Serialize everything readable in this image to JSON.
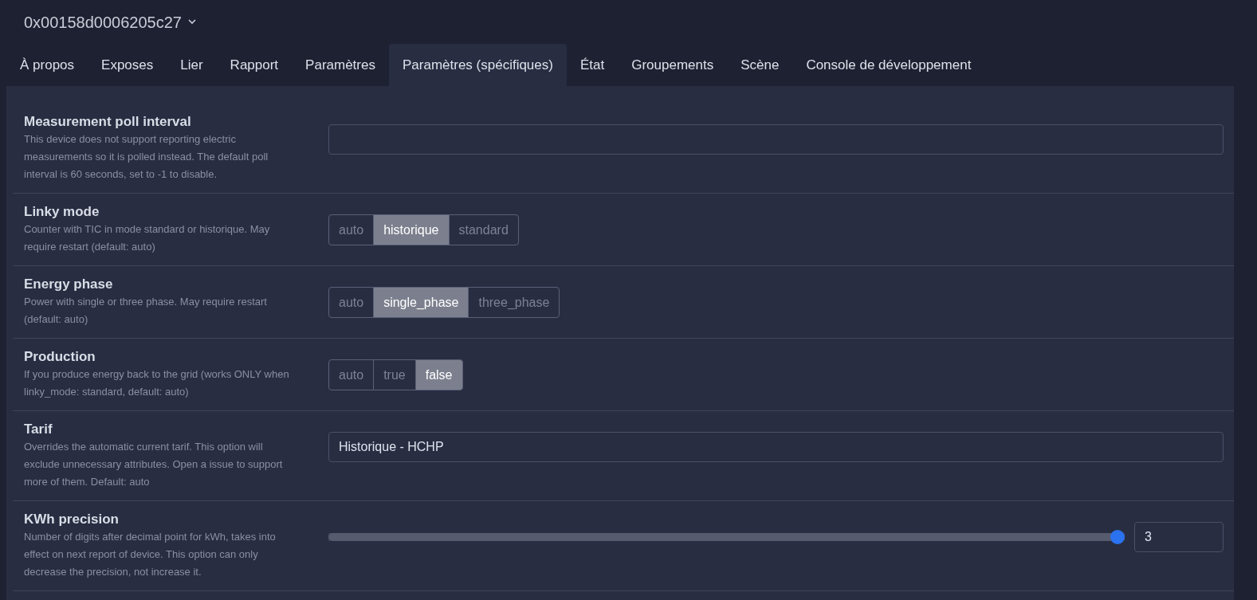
{
  "device": {
    "title": "0x00158d0006205c27"
  },
  "tabs": [
    {
      "label": "À propos",
      "selected": false
    },
    {
      "label": "Exposes",
      "selected": false
    },
    {
      "label": "Lier",
      "selected": false
    },
    {
      "label": "Rapport",
      "selected": false
    },
    {
      "label": "Paramètres",
      "selected": false
    },
    {
      "label": "Paramètres (spécifiques)",
      "selected": true
    },
    {
      "label": "État",
      "selected": false
    },
    {
      "label": "Groupements",
      "selected": false
    },
    {
      "label": "Scène",
      "selected": false
    },
    {
      "label": "Console de développement",
      "selected": false
    }
  ],
  "settings": [
    {
      "kind": "text",
      "title": "Measurement poll interval",
      "description": "This device does not support reporting electric measurements so it is polled instead. The default poll interval is 60 seconds, set to -1 to disable."
    },
    {
      "kind": "radio",
      "title": "Linky mode",
      "description": "Counter with TIC in mode standard or historique. May require restart (default: auto)",
      "options": [
        {
          "label": "auto",
          "selected": false
        },
        {
          "label": "historique",
          "selected": true
        },
        {
          "label": "standard",
          "selected": false
        }
      ]
    },
    {
      "kind": "radio",
      "title": "Energy phase",
      "description": "Power with single or three phase. May require restart (default: auto)",
      "options": [
        {
          "label": "auto",
          "selected": false
        },
        {
          "label": "single_phase",
          "selected": true
        },
        {
          "label": "three_phase",
          "selected": false
        }
      ]
    },
    {
      "kind": "radio",
      "title": "Production",
      "description": "If you produce energy back to the grid (works ONLY when linky_mode: standard, default: auto)",
      "options": [
        {
          "label": "auto",
          "selected": false
        },
        {
          "label": "true",
          "selected": false
        },
        {
          "label": "false",
          "selected": true
        }
      ]
    },
    {
      "kind": "text",
      "title": "Tarif",
      "description": "Overrides the automatic current tarif. This option will exclude unnecessary attributes. Open a issue to support more of them. Default: auto",
      "value": "Historique - HCHP"
    },
    {
      "kind": "slider",
      "title": "KWh precision",
      "description": "Number of digits after decimal point for kWh, takes into effect on next report of device. This option can only decrease the precision, not increase it.",
      "level": 1,
      "value": "3"
    }
  ]
}
